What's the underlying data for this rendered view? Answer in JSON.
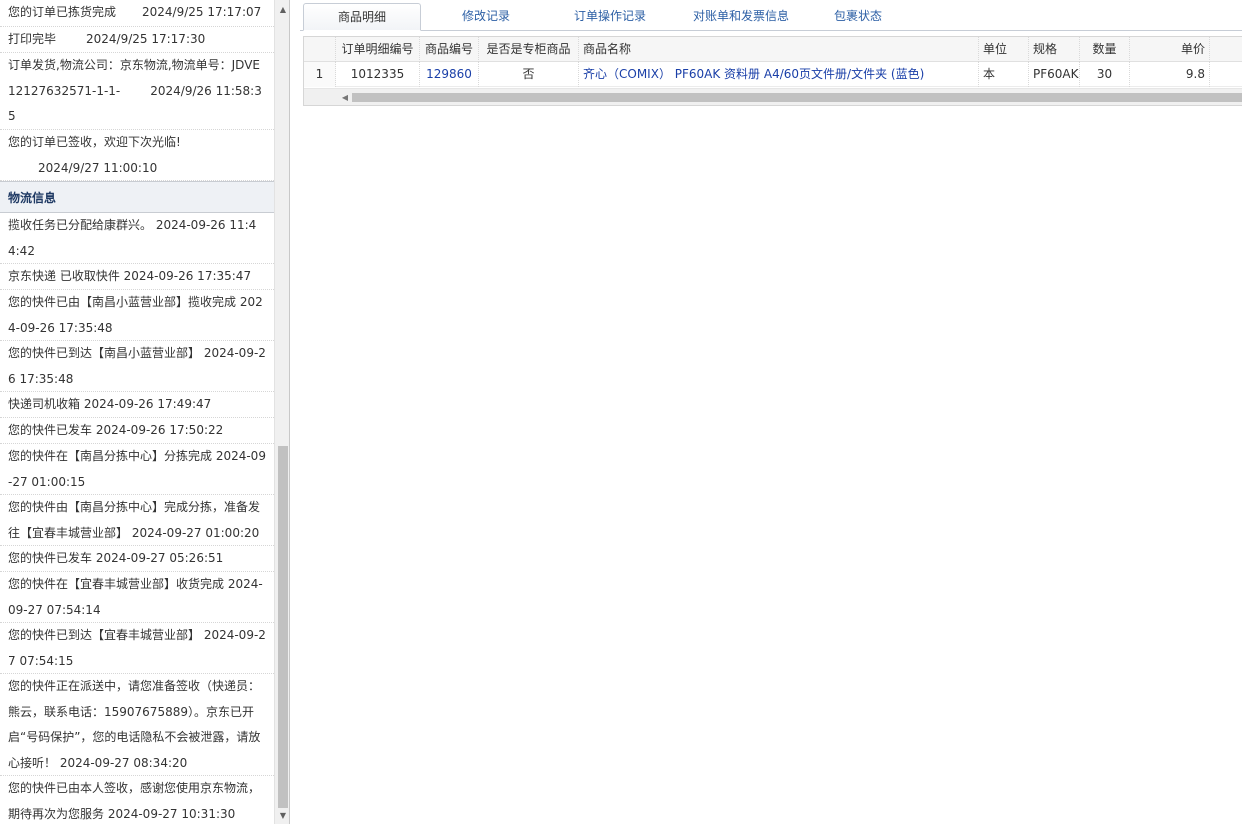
{
  "order_log": {
    "items": [
      {
        "text": "您的订单已拣货完成",
        "time": "2024/9/25 17:17:07"
      },
      {
        "text": "打印完毕",
        "time": "2024/9/25 17:17:30"
      },
      {
        "text": "订单发货,物流公司：京东物流,物流单号：JDVE12127632571-1-1-",
        "time": "2024/9/26 11:58:35"
      },
      {
        "text": "您的订单已签收，欢迎下次光临!",
        "time": "2024/9/27 11:00:10"
      }
    ]
  },
  "logistics": {
    "header": "物流信息",
    "items": [
      "揽收任务已分配给康群兴。 2024-09-26 11:44:42",
      "京东快递 已收取快件 2024-09-26 17:35:47",
      "您的快件已由【南昌小蓝营业部】揽收完成 2024-09-26 17:35:48",
      "您的快件已到达【南昌小蓝营业部】 2024-09-26 17:35:48",
      "快递司机收箱 2024-09-26 17:49:47",
      "您的快件已发车 2024-09-26 17:50:22",
      "您的快件在【南昌分拣中心】分拣完成 2024-09-27 01:00:15",
      "您的快件由【南昌分拣中心】完成分拣，准备发往【宜春丰城营业部】 2024-09-27 01:00:20",
      "您的快件已发车 2024-09-27 05:26:51",
      "您的快件在【宜春丰城营业部】收货完成 2024-09-27 07:54:14",
      "您的快件已到达【宜春丰城营业部】 2024-09-27 07:54:15",
      "您的快件正在派送中，请您准备签收（快递员：熊云，联系电话：15907675889）。京东已开启“号码保护”，您的电话隐私不会被泄露，请放心接听！ 2024-09-27 08:34:20",
      "您的快件已由本人签收，感谢您使用京东物流，期待再次为您服务 2024-09-27 10:31:30"
    ]
  },
  "tabs": [
    {
      "label": "商品明细",
      "active": true
    },
    {
      "label": "修改记录",
      "active": false
    },
    {
      "label": "订单操作记录",
      "active": false
    },
    {
      "label": "对账单和发票信息",
      "active": false
    },
    {
      "label": "包裹状态",
      "active": false
    }
  ],
  "grid": {
    "columns": [
      "订单明细编号",
      "商品编号",
      "是否是专柜商品",
      "商品名称",
      "单位",
      "规格",
      "数量",
      "单价"
    ],
    "rows": [
      {
        "row_number": "1",
        "detail_id": "1012335",
        "product_id": "129860",
        "is_counter": "否",
        "name": "齐心（COMIX） PF60AK 资料册 A4/60页文件册/文件夹 (蓝色)",
        "unit": "本",
        "spec": "PF60AK",
        "qty": "30",
        "price": "9.8"
      }
    ]
  },
  "icons": {
    "scroll_up": "scroll-up-arrow-icon",
    "scroll_down": "scroll-down-arrow-icon",
    "scroll_left": "scroll-left-arrow-icon"
  },
  "colors": {
    "link": "#1a3fa8",
    "tab_text": "#2c5fa5",
    "section_header": "#1f3a64"
  }
}
